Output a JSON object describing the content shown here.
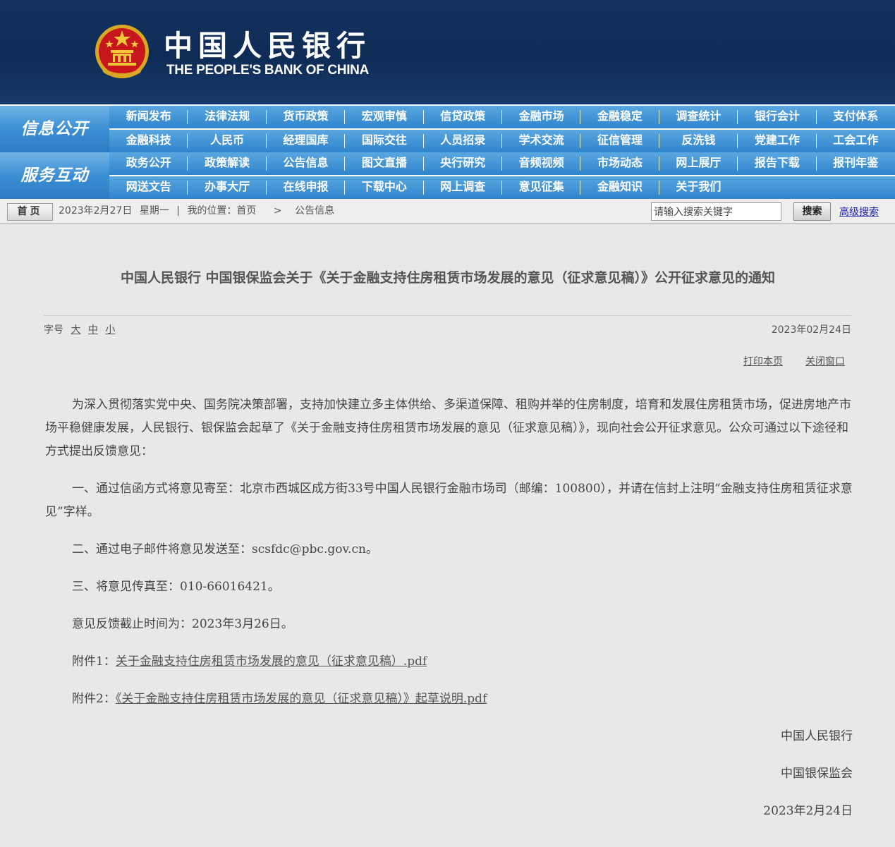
{
  "header": {
    "brand_cn": "中国人民银行",
    "brand_en": "THE PEOPLE'S BANK OF CHINA",
    "emblem_icon": "national-emblem-icon"
  },
  "nav": {
    "block1_label": "信息公开",
    "block2_label": "服务互动",
    "row1": [
      "新闻发布",
      "法律法规",
      "货币政策",
      "宏观审慎",
      "信贷政策",
      "金融市场",
      "金融稳定",
      "调查统计",
      "银行会计",
      "支付体系"
    ],
    "row2": [
      "金融科技",
      "人民币",
      "经理国库",
      "国际交往",
      "人员招录",
      "学术交流",
      "征信管理",
      "反洗钱",
      "党建工作",
      "工会工作"
    ],
    "row3": [
      "政务公开",
      "政策解读",
      "公告信息",
      "图文直播",
      "央行研究",
      "音频视频",
      "市场动态",
      "网上展厅",
      "报告下载",
      "报刊年鉴"
    ],
    "row4": [
      "网送文告",
      "办事大厅",
      "在线申报",
      "下载中心",
      "网上调查",
      "意见征集",
      "金融知识",
      "关于我们"
    ]
  },
  "crumb": {
    "home_label": "首页",
    "date": "2023年2月27日",
    "weekday": "星期一",
    "separator": "|",
    "location_label": "我的位置：首页",
    "arrow": ">",
    "current": "公告信息",
    "search_placeholder": "请输入搜索关键字",
    "search_button": "搜索",
    "advanced_search": "高级搜索"
  },
  "article": {
    "title": "中国人民银行  中国银保监会关于《关于金融支持住房租赁市场发展的意见（征求意见稿）》公开征求意见的通知",
    "font_label": "字号",
    "font_large": "大",
    "font_medium": "中",
    "font_small": "小",
    "date": "2023年02月24日",
    "print": "打印本页",
    "close": "关闭窗口",
    "p1": "为深入贯彻落实党中央、国务院决策部署，支持加快建立多主体供给、多渠道保障、租购并举的住房制度，培育和发展住房租赁市场，促进房地产市场平稳健康发展，人民银行、银保监会起草了《关于金融支持住房租赁市场发展的意见（征求意见稿）》，现向社会公开征求意见。公众可通过以下途径和方式提出反馈意见：",
    "p2": "一、通过信函方式将意见寄至：北京市西城区成方街33号中国人民银行金融市场司（邮编：100800），并请在信封上注明“金融支持住房租赁征求意见”字样。",
    "p3": "二、通过电子邮件将意见发送至：scsfdc@pbc.gov.cn。",
    "p4": "三、将意见传真至：010-66016421。",
    "p5": "意见反馈截止时间为：2023年3月26日。",
    "attach1_label": "附件1：",
    "attach1_link": "关于金融支持住房租赁市场发展的意见（征求意见稿）.pdf",
    "attach2_label": "附件2：",
    "attach2_link": "《关于金融支持住房租赁市场发展的意见（征求意见稿）》起草说明.pdf",
    "sign1": "中国人民银行",
    "sign2": "中国银保监会",
    "sign_date": "2023年2月24日"
  }
}
